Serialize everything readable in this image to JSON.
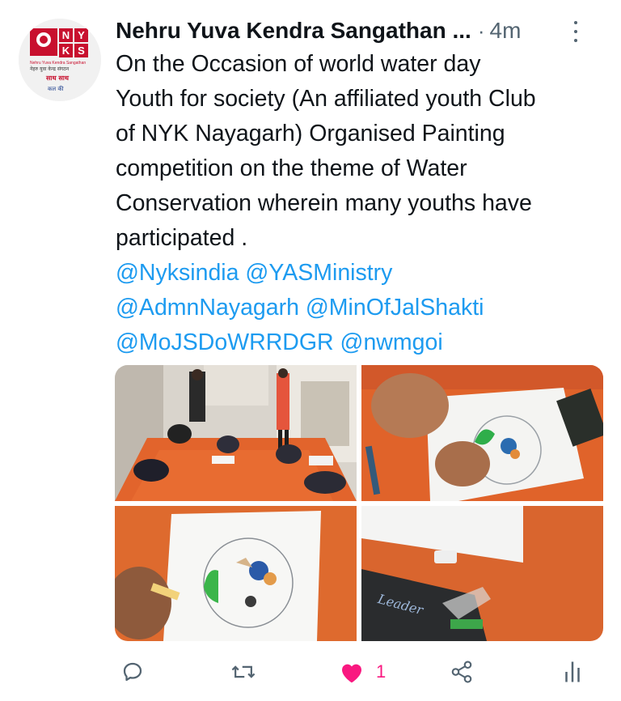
{
  "tweet": {
    "display_name": "Nehru Yuva Kendra Sangathan ...",
    "separator": "·",
    "timestamp": "4m",
    "text_lines": [
      "On the Occasion of world water day",
      "Youth for society (An affiliated youth Club",
      "of NYK Nayagarh) Organised Painting",
      "competition on the theme of Water",
      "Conservation wherein many youths have",
      "participated ."
    ],
    "mention_lines": [
      "@Nyksindia @YASMinistry",
      "@AdmnNayagarh @MinOfJalShakti",
      "@MoJSDoWRRDGR @nwmgoi"
    ],
    "like_count": "1"
  },
  "avatar_logo": {
    "letters": [
      "N",
      "Y",
      "K",
      "S"
    ],
    "org_name_en": "Nehru Yuva Kendra Sangathan",
    "org_name_hi": "नेहरु युवा केन्द्र संगठन",
    "slogan_1": "साथ साथ",
    "slogan_2": "कल की"
  },
  "icons": {
    "reply": "reply-icon",
    "retweet": "retweet-icon",
    "like": "heart-icon",
    "share": "share-icon",
    "analytics": "analytics-icon",
    "more": "more-options-icon"
  },
  "colors": {
    "text": "#0f1419",
    "secondary": "#536471",
    "link": "#1d9bf0",
    "like": "#f91880",
    "logo_red": "#c8102e"
  }
}
